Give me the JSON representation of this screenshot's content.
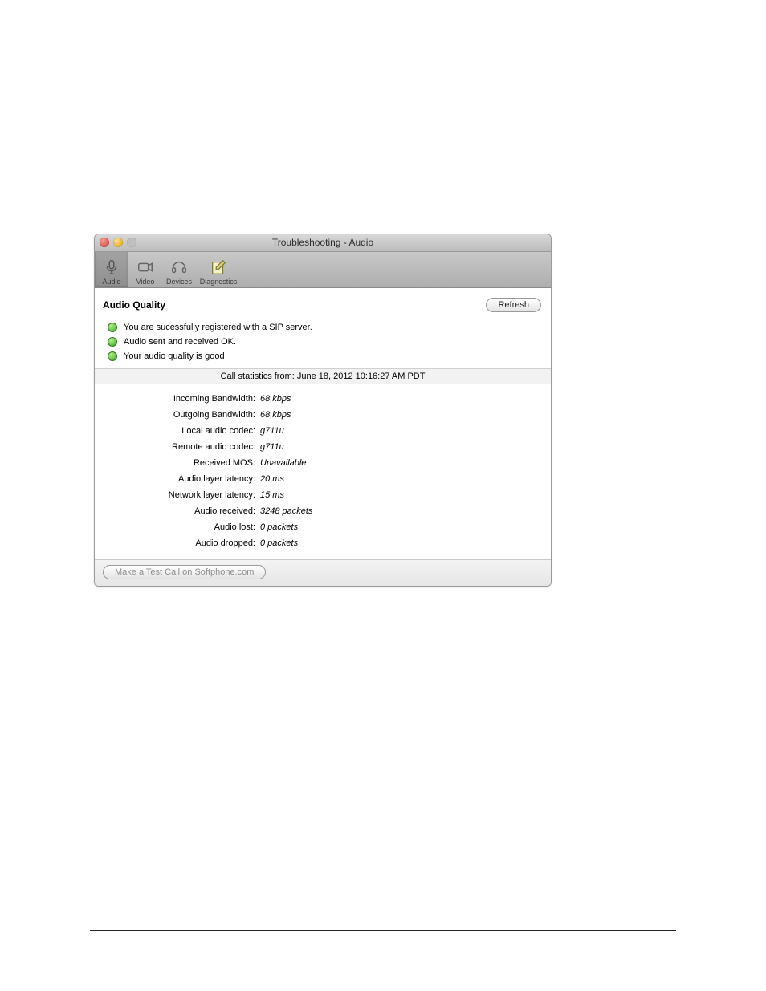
{
  "window": {
    "title": "Troubleshooting - Audio",
    "traffic": {
      "close": "close",
      "minimize": "minimize",
      "zoom": "zoom"
    }
  },
  "tabs": {
    "audio": "Audio",
    "video": "Video",
    "devices": "Devices",
    "diagnostics": "Diagnostics"
  },
  "section": {
    "title": "Audio Quality",
    "refresh": "Refresh"
  },
  "status": [
    "You are sucessfully registered with a SIP server.",
    "Audio sent and received OK.",
    "Your audio quality is good"
  ],
  "stats_header": "Call statistics from: June 18, 2012 10:16:27 AM PDT",
  "stats": [
    {
      "label": "Incoming Bandwidth:",
      "value": "68 kbps"
    },
    {
      "label": "Outgoing Bandwidth:",
      "value": "68 kbps"
    },
    {
      "label": "Local audio codec:",
      "value": "g711u"
    },
    {
      "label": "Remote audio codec:",
      "value": "g711u"
    },
    {
      "label": "Received MOS:",
      "value": "Unavailable"
    },
    {
      "label": "Audio layer latency:",
      "value": "20 ms"
    },
    {
      "label": "Network layer latency:",
      "value": "15 ms"
    },
    {
      "label": "Audio received:",
      "value": "3248 packets"
    },
    {
      "label": "Audio lost:",
      "value": "0 packets"
    },
    {
      "label": "Audio dropped:",
      "value": "0 packets"
    }
  ],
  "footer": {
    "test_call": "Make a Test Call on Softphone.com"
  }
}
